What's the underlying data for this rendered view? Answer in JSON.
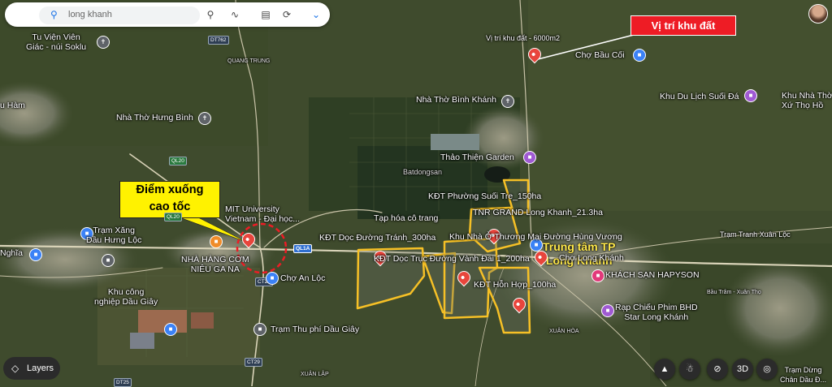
{
  "search": {
    "value": "long khanh"
  },
  "callouts": {
    "land_location": "Vị trí khu đất",
    "exit_line1": "Điểm xuống",
    "exit_line2": "cao tốc",
    "center_line1": "Trung tâm TP",
    "center_line2": "Long Khánh"
  },
  "places": {
    "tu_vien": [
      "Tu Viện Viên",
      "Giác - núi Soklu"
    ],
    "vi_tri": "Vị trí khu đất - 6000m2",
    "cho_bau_coi": "Chợ Bầu Cối",
    "nha_tho_binh_khanh": "Nhà Thờ Bình Khánh",
    "khu_du_lich": "Khu Du Lịch Suối Đá",
    "xu_tho": [
      "Khu Nhà Thờ",
      "Xứ Thọ Hồ"
    ],
    "u_ham": "u Hàm",
    "nha_tho_hung_binh": "Nhà Thờ Hưng Bình",
    "thao_thien": "Thảo Thiện Garden",
    "kdt_phuong_suoi_tre": "KĐT Phường Suối Tre_150ha",
    "tnr_grand": "TNR GRAND Long Khanh_21.3ha",
    "mit": [
      "MIT University",
      "Vietnam - Đại học..."
    ],
    "tram_xang": [
      "Trạm Xăng",
      "Dầu Hưng Lộc"
    ],
    "tap_hoa": "Tạp hóa cô trang",
    "kdt_doc_duong_tranh": "KĐT Dọc Đường Tránh_300ha",
    "khu_nha_o": "Khu Nhà Ở Thương Mại Đường Hùng Vương",
    "kdt_vanh_dai": "KĐT Dọc Trục Đường Vành Đai 1_200ha",
    "cho_long_khanh": "Chợ Long Khánh",
    "nghia": "Nghĩa",
    "nha_hang": [
      "NHÀ HÀNG CƠM",
      "NIÊU GA NA"
    ],
    "cho_an_loc": "Chợ An Lộc",
    "kdt_hon_hop": "KĐT Hỗn Hợp_100ha",
    "khach_san": "KHÁCH SẠN HAPYSON",
    "khu_cong_nghiep": [
      "Khu công",
      "nghiệp Dầu Giây"
    ],
    "rap_chieu": [
      "Rạp Chiếu Phim BHD",
      "Star Long Khánh"
    ],
    "tram_thu_phi": "Trạm Thu phí Dầu Giây",
    "tram_tranh": "Trạm Tranh Xuân Lộc",
    "tram_dung": [
      "Trạm Dừng",
      "Chân Dầu Đ..."
    ],
    "quang_trung": "QUANG TRUNG",
    "xuan_hoa": "XUÂN HÒA",
    "xuan_lap": "XUÂN LẬP",
    "bau_tram": "Bầu Trâm - Xuân Thọ",
    "watermark": "Batdongsan"
  },
  "roads": {
    "dt762": "DT762",
    "ql20a": "QL20",
    "ql20b": "QL20",
    "ql1a": "QL1A",
    "ct29a": "CT29",
    "ct29b": "CT29",
    "dt25": "DT25"
  },
  "controls": {
    "layers": "Layers",
    "mode_3d": "3D",
    "compass": "N"
  },
  "colors": {
    "callout_red": "#ee1c25",
    "callout_yellow": "#fff200",
    "zone_outline": "#f6c026",
    "pin_red": "#e8453c",
    "highway_blue": "#2f6fd0"
  }
}
